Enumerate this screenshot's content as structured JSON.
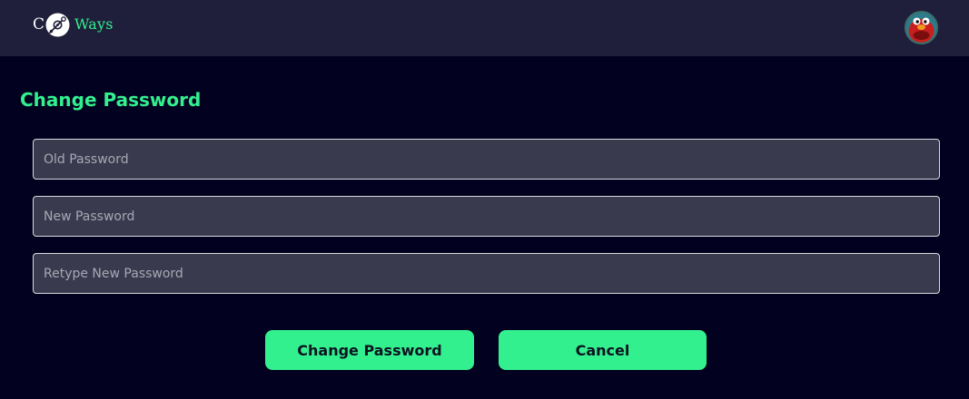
{
  "header": {
    "logo": {
      "prefix": "C",
      "icon": "disc-icon",
      "suffix": "Ways"
    },
    "avatar": {
      "icon": "user-avatar"
    }
  },
  "main": {
    "title": "Change Password",
    "fields": {
      "old_password": {
        "placeholder": "Old Password",
        "value": ""
      },
      "new_password": {
        "placeholder": "New Password",
        "value": ""
      },
      "retype_password": {
        "placeholder": "Retype New Password",
        "value": ""
      }
    },
    "buttons": {
      "change_label": "Change Password",
      "cancel_label": "Cancel"
    }
  },
  "colors": {
    "background": "#020220",
    "header": "#1f1f3b",
    "accent": "#33f08f",
    "input_background": "#3a3a4f",
    "input_border": "#d9d9e0"
  }
}
